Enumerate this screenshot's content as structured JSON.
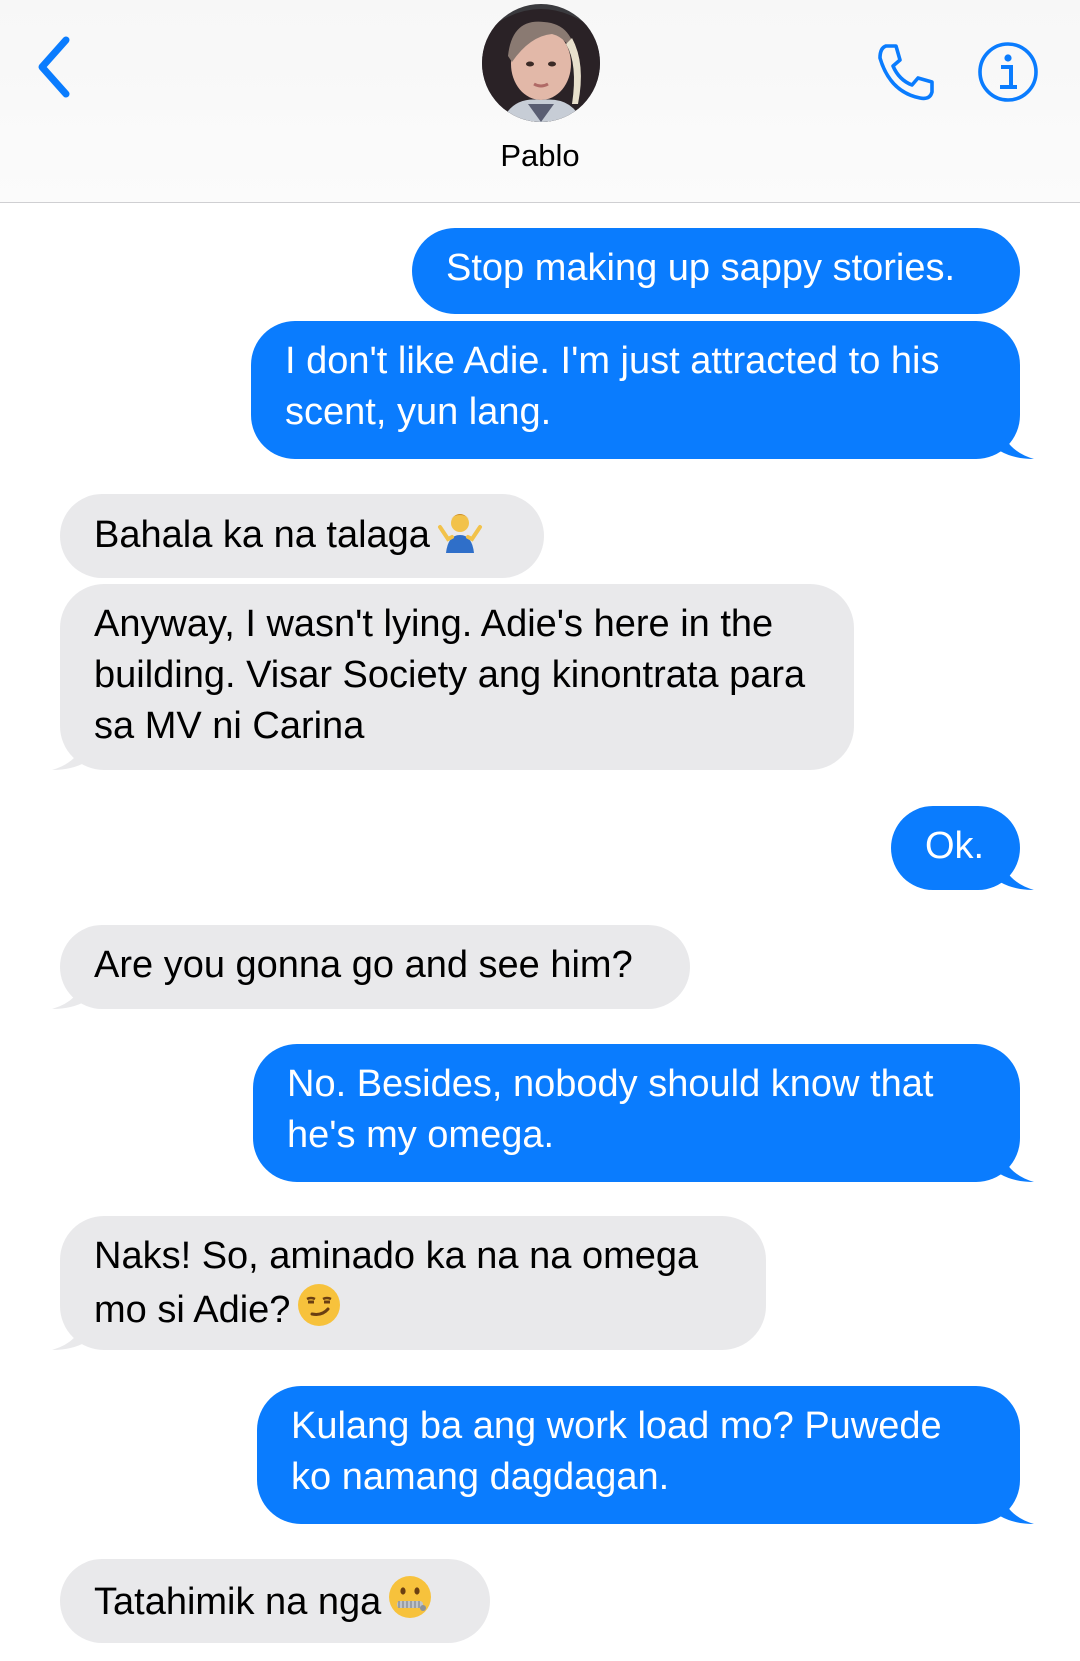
{
  "header": {
    "contact_name": "Pablo",
    "accent_color": "#0a7cfe",
    "icons": [
      "chevron-left-icon",
      "phone-icon",
      "info-icon"
    ]
  },
  "messages": [
    {
      "from": "me",
      "text": "Stop making up sappy stories."
    },
    {
      "from": "me",
      "text": "I don't like Adie. I'm just attracted to his scent, yun lang."
    },
    {
      "from": "them",
      "text": "Bahala ka na talaga",
      "emoji": "person-shrugging"
    },
    {
      "from": "them",
      "text": "Anyway, I wasn't lying. Adie's here in the building. Visar Society ang kinontrata para sa MV ni Carina"
    },
    {
      "from": "me",
      "text": "Ok."
    },
    {
      "from": "them",
      "text": "Are you gonna go and see him?"
    },
    {
      "from": "me",
      "text": "No. Besides, nobody should know that he's my omega."
    },
    {
      "from": "them",
      "text": "Naks! So, aminado ka na na omega mo si Adie?",
      "emoji": "smirking-face"
    },
    {
      "from": "me",
      "text": "Kulang ba ang work load mo? Puwede ko namang dagdagan."
    },
    {
      "from": "them",
      "text": "Tatahimik na nga",
      "emoji": "zipper-mouth-face"
    }
  ]
}
